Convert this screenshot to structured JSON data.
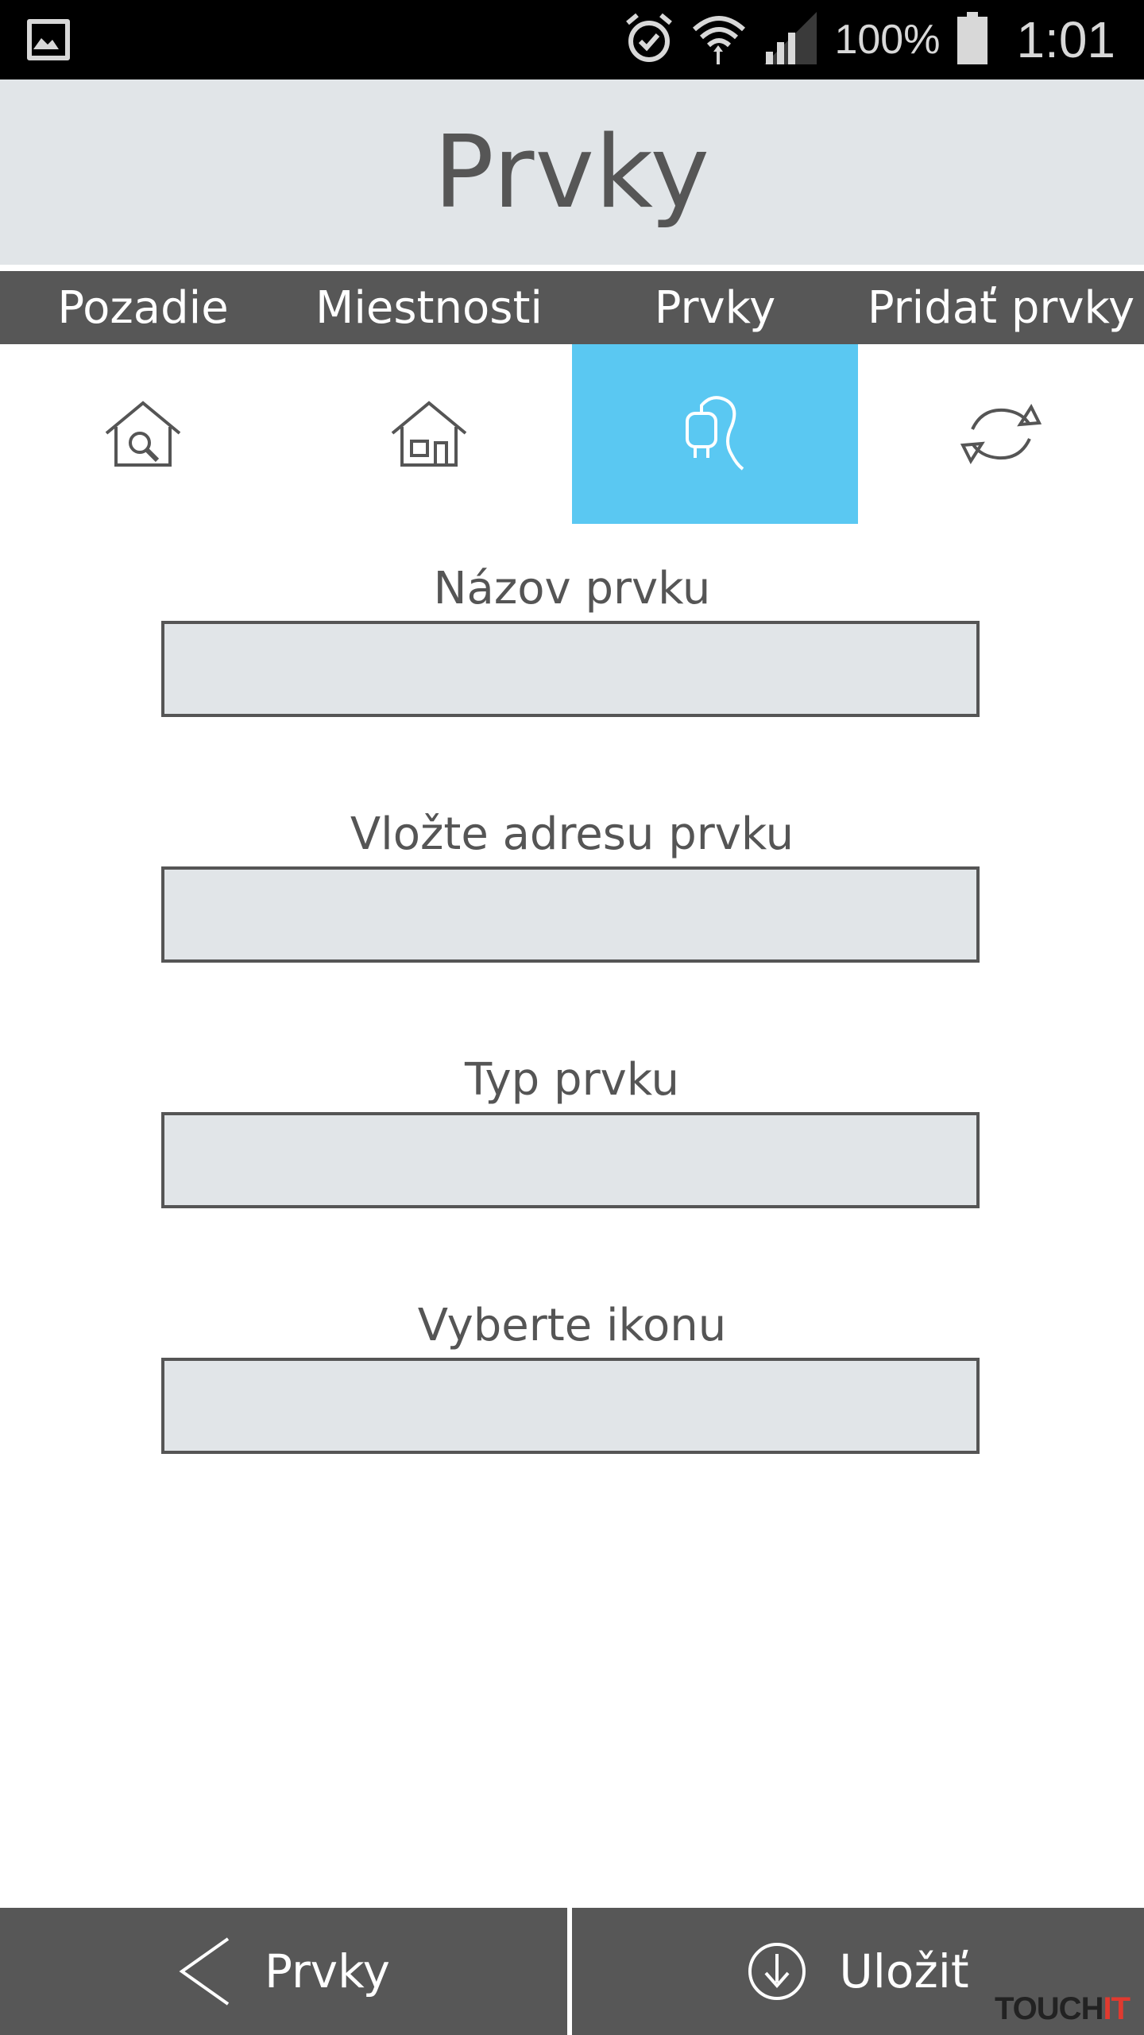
{
  "status_bar": {
    "battery": "100%",
    "time": "1:01",
    "icons": [
      "gallery-icon",
      "alarm-icon",
      "wifi-icon",
      "signal-icon",
      "battery-icon"
    ]
  },
  "header": {
    "title": "Prvky"
  },
  "tabs": [
    {
      "label": "Pozadie"
    },
    {
      "label": "Miestnosti"
    },
    {
      "label": "Prvky"
    },
    {
      "label": "Pridať prvky"
    }
  ],
  "icon_tabs": [
    {
      "icon": "house-search-icon",
      "active": false
    },
    {
      "icon": "house-icon",
      "active": false
    },
    {
      "icon": "plug-icon",
      "active": true
    },
    {
      "icon": "sync-icon",
      "active": false
    }
  ],
  "form": {
    "fields": [
      {
        "label": "Názov prvku",
        "value": ""
      },
      {
        "label": "Vložte adresu prvku",
        "value": ""
      },
      {
        "label": "Typ prvku",
        "value": ""
      },
      {
        "label": "Vyberte ikonu",
        "value": ""
      }
    ]
  },
  "bottom_bar": {
    "back_label": "Prvky",
    "save_label": "Uložiť"
  },
  "watermark": {
    "main": "TOUCH",
    "accent": "IT"
  },
  "colors": {
    "active_tab": "#5ac8f2",
    "bar_dark": "#575757",
    "header_bg": "#e1e5e8",
    "input_bg": "#e1e5e8"
  }
}
